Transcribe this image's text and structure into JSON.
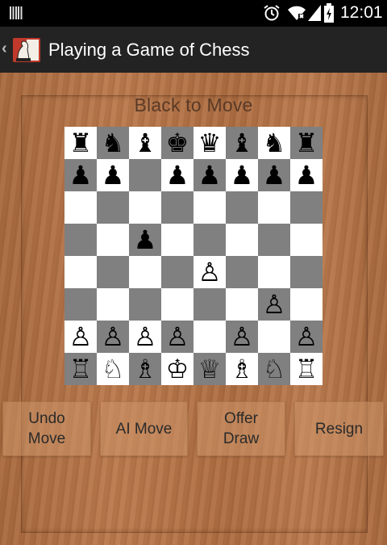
{
  "status_bar": {
    "time": "12:01"
  },
  "action_bar": {
    "back_glyph": "‹",
    "title": "Playing a Game of Chess"
  },
  "game": {
    "turn_text": "Black to Move"
  },
  "board": {
    "ranks": [
      [
        "♜",
        "♞",
        "♝",
        "♚",
        "♛",
        "♝",
        "♞",
        "♜"
      ],
      [
        "♟",
        "♟",
        "",
        "♟",
        "♟",
        "♟",
        "♟",
        "♟"
      ],
      [
        "",
        "",
        "",
        "",
        "",
        "",
        "",
        ""
      ],
      [
        "",
        "",
        "♟",
        "",
        "",
        "",
        "",
        ""
      ],
      [
        "",
        "",
        "",
        "",
        "♙",
        "",
        "",
        ""
      ],
      [
        "",
        "",
        "",
        "",
        "",
        "",
        "♙",
        ""
      ],
      [
        "♙",
        "♙",
        "♙",
        "♙",
        "",
        "♙",
        "",
        "♙"
      ],
      [
        "♖",
        "♘",
        "♗",
        "♔",
        "♕",
        "♗",
        "♘",
        "♖"
      ]
    ]
  },
  "buttons": {
    "undo": "Undo\nMove",
    "ai": "AI Move",
    "draw": "Offer\nDraw",
    "resign": "Resign"
  }
}
